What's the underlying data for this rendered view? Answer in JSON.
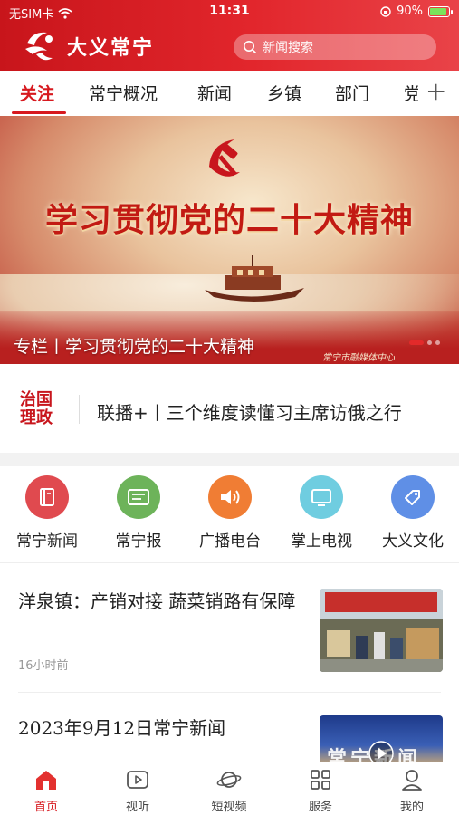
{
  "status_bar": {
    "carrier": "无SIM卡",
    "time": "11:31",
    "battery": "90%"
  },
  "brand": {
    "name": "大义常宁"
  },
  "search": {
    "placeholder": "新闻搜索"
  },
  "tabs": [
    {
      "label": "关注",
      "active": true
    },
    {
      "label": "常宁概况"
    },
    {
      "label": "新闻"
    },
    {
      "label": "乡镇"
    },
    {
      "label": "部门"
    },
    {
      "label": "党"
    }
  ],
  "tab_add_label": "+",
  "banner": {
    "title": "学习贯彻党的二十大精神",
    "caption": "专栏丨学习贯彻党的二十大精神",
    "source": "常宁市融媒体中心"
  },
  "headline": {
    "tag": "治国理政",
    "text": "联播+丨三个维度读懂习主席访俄之行"
  },
  "shortcuts": [
    {
      "label": "常宁新闻",
      "icon": "book-icon",
      "color": "#e04a4f"
    },
    {
      "label": "常宁报",
      "icon": "newspaper-icon",
      "color": "#6db35a"
    },
    {
      "label": "广播电台",
      "icon": "speaker-icon",
      "color": "#f07d34"
    },
    {
      "label": "掌上电视",
      "icon": "tv-icon",
      "color": "#6fcde0"
    },
    {
      "label": "大义文化",
      "icon": "tag-icon",
      "color": "#5f8fe6"
    }
  ],
  "news": [
    {
      "title": "洋泉镇：产销对接 蔬菜销路有保障",
      "time": "16小时前"
    },
    {
      "title": "2023年9月12日常宁新闻",
      "thumb_text": "常宁新闻"
    }
  ],
  "bottom_nav": [
    {
      "label": "首页",
      "icon": "home-icon",
      "active": true
    },
    {
      "label": "视听",
      "icon": "play-icon"
    },
    {
      "label": "短视频",
      "icon": "planet-icon"
    },
    {
      "label": "服务",
      "icon": "grid-icon"
    },
    {
      "label": "我的",
      "icon": "user-icon"
    }
  ],
  "colors": {
    "brand_red": "#d7191f",
    "header_red": "#e2262c"
  }
}
